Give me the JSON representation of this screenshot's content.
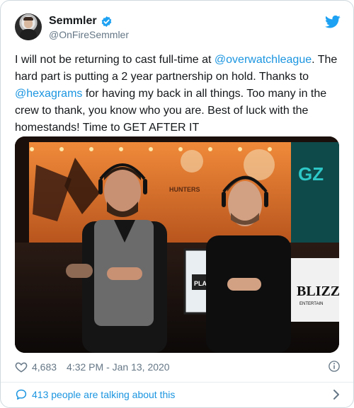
{
  "author": {
    "name": "Semmler",
    "handle": "@OnFireSemmler",
    "verified": true
  },
  "tweet": {
    "text_parts": [
      {
        "type": "text",
        "value": "I will not be returning to cast full-time at "
      },
      {
        "type": "mention",
        "value": "@overwatchleague"
      },
      {
        "type": "text",
        "value": ". The hard part is putting a 2 year partnership on hold. Thanks to "
      },
      {
        "type": "mention",
        "value": "@hexagrams"
      },
      {
        "type": "text",
        "value": " for having my back in all things. Too many in the crew to thank, you know who you are. Best of luck with the homestands! Time to GET AFTER IT"
      }
    ]
  },
  "media": {
    "signs": [
      "HUNTERS",
      "GZ",
      "PLA",
      "BLIZZA",
      "ENTERTAIN"
    ]
  },
  "meta": {
    "likes": "4,683",
    "timestamp": "4:32 PM - Jan 13, 2020"
  },
  "footer": {
    "label": "413 people are talking about this"
  },
  "colors": {
    "accent": "#1b95e0",
    "secondary_text": "#657786",
    "text": "#14171a"
  },
  "icons": [
    "twitter-bird-icon",
    "verified-badge-icon",
    "heart-icon",
    "info-icon",
    "speech-bubble-icon",
    "chevron-right-icon"
  ]
}
